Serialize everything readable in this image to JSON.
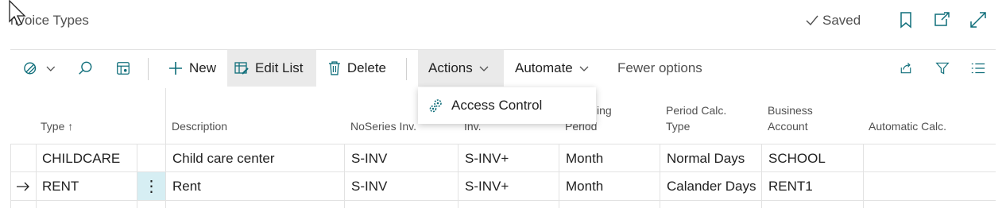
{
  "header": {
    "title": "nvoice Types",
    "saved_label": "Saved"
  },
  "toolbar": {
    "new_label": "New",
    "edit_list_label": "Edit List",
    "delete_label": "Delete",
    "actions_label": "Actions",
    "automate_label": "Automate",
    "fewer_options_label": "Fewer options"
  },
  "actions_menu": {
    "items": [
      {
        "label": "Access Control"
      }
    ]
  },
  "table": {
    "columns": [
      {
        "label": "Type ↑"
      },
      {
        "label": "Description"
      },
      {
        "label": "NoSeries Inv."
      },
      {
        "label": "Inv."
      },
      {
        "label_line1": "ing",
        "label_line2": "Period"
      },
      {
        "label_line1": "Period Calc.",
        "label_line2": "Type"
      },
      {
        "label_line1": "Business",
        "label_line2": "Account"
      },
      {
        "label": "Automatic Calc."
      }
    ],
    "rows": [
      {
        "type": "CHILDCARE",
        "description": "Child care center",
        "noseries_inv": "S-INV",
        "inv": "S-INV+",
        "period": "Month",
        "calc_type": "Normal Days",
        "business_account": "SCHOOL",
        "automatic_calc": ""
      },
      {
        "type": "RENT",
        "description": "Rent",
        "noseries_inv": "S-INV",
        "inv": "S-INV+",
        "period": "Month",
        "calc_type": "Calander Days",
        "business_account": "RENT1",
        "automatic_calc": ""
      }
    ]
  },
  "colors": {
    "accent": "#0f6e7a",
    "selected_cell": "#d6eef3",
    "button_hover": "#eaeaea"
  },
  "icons": [
    "cursor-arrow-icon",
    "checkmark-icon",
    "bookmark-icon",
    "open-new-window-icon",
    "expand-icon",
    "filter-toggle-icon",
    "chevron-down-icon",
    "search-icon",
    "personalize-icon",
    "plus-icon",
    "edit-list-icon",
    "trash-icon",
    "share-icon",
    "filter-icon",
    "list-view-icon",
    "access-control-icon",
    "row-arrow-icon",
    "more-options-icon"
  ]
}
